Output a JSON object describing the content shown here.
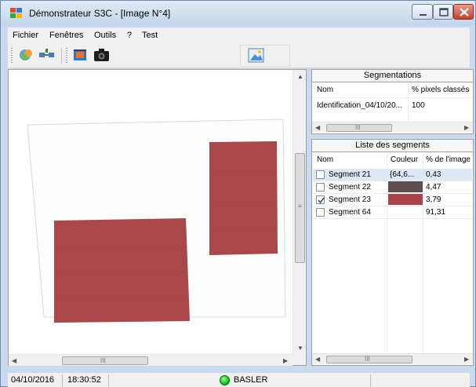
{
  "window": {
    "title": "Démonstrateur S3C - [Image N°4]"
  },
  "menu": {
    "items": [
      "Fichier",
      "Fenêtres",
      "Outils",
      "?",
      "Test"
    ]
  },
  "toolbar": {
    "buttons": [
      "segmentation-icon",
      "network-icon",
      "film-icon",
      "camera-icon",
      "image-icon"
    ]
  },
  "segmentations": {
    "title": "Segmentations",
    "columns": [
      "Nom",
      "% pixels classés"
    ],
    "rows": [
      {
        "name": "Identification_04/10/20...",
        "percent": "100"
      }
    ],
    "scroll_grip": "III"
  },
  "segments": {
    "title": "Liste des segments",
    "columns": [
      "Nom",
      "Couleur",
      "% de l'image"
    ],
    "rows": [
      {
        "name": "Segment 21",
        "color_text": "{64,6...",
        "color_hex": "",
        "percent": "0,43",
        "checked": false
      },
      {
        "name": "Segment 22",
        "color_text": "",
        "color_hex": "#5e4e4f",
        "percent": "4,47",
        "checked": false
      },
      {
        "name": "Segment 23",
        "color_text": "",
        "color_hex": "#a94448",
        "percent": "3,79",
        "checked": true
      },
      {
        "name": "Segment 64",
        "color_text": "",
        "color_hex": "",
        "percent": "91,31",
        "checked": false
      }
    ],
    "scroll_grip": "III"
  },
  "viewer": {
    "scroll_grip_v": "≡",
    "scroll_grip_h": "III",
    "region_color": "#a8484a"
  },
  "status": {
    "date": "04/10/2016",
    "time": "18:30:52",
    "camera": "BASLER",
    "camera_led_color": "#18c21e"
  }
}
